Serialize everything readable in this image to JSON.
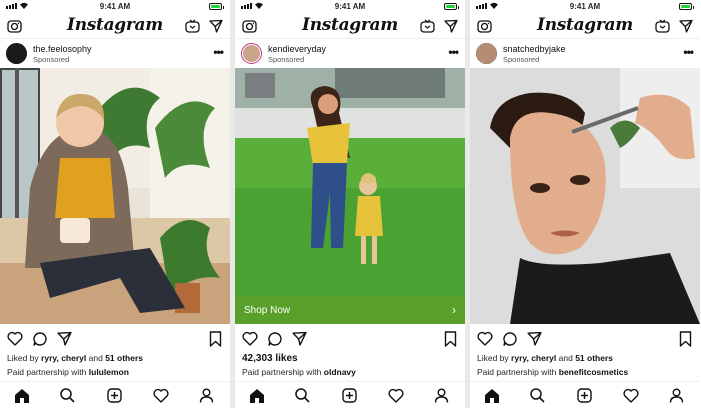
{
  "status_bar": {
    "time": "9:41 AM"
  },
  "app": {
    "logo": "Instagram"
  },
  "navbar_icons": [
    "camera-icon",
    "igtv-icon",
    "direct-message-icon"
  ],
  "tab_icons": [
    "home-icon",
    "search-icon",
    "add-post-icon",
    "activity-heart-icon",
    "profile-icon"
  ],
  "colors": {
    "battery": "#1fd13a",
    "story_ring": "#c13584",
    "cta_green": "#5aa028"
  },
  "posts": [
    {
      "username": "the.feelosophy",
      "sponsored_label": "Sponsored",
      "more_label": "•••",
      "liked_prefix": "Liked by",
      "liked_names": "ryry, cheryl",
      "liked_and": "and",
      "liked_others": "51 others",
      "partnership_prefix": "Paid partnership with",
      "partner": "lululemon"
    },
    {
      "username": "kendieveryday",
      "sponsored_label": "Sponsored",
      "more_label": "•••",
      "cta_label": "Shop Now",
      "cta_chevron": "›",
      "likes": "42,303 likes",
      "partnership_prefix": "Paid partnership with",
      "partner": "oldnavy"
    },
    {
      "username": "snatchedbyjake",
      "sponsored_label": "Sponsored",
      "more_label": "•••",
      "liked_prefix": "Liked by",
      "liked_names": "ryry, cheryl",
      "liked_and": "and",
      "liked_others": "51 others",
      "partnership_prefix": "Paid partnership with",
      "partner": "benefitcosmetics"
    }
  ]
}
